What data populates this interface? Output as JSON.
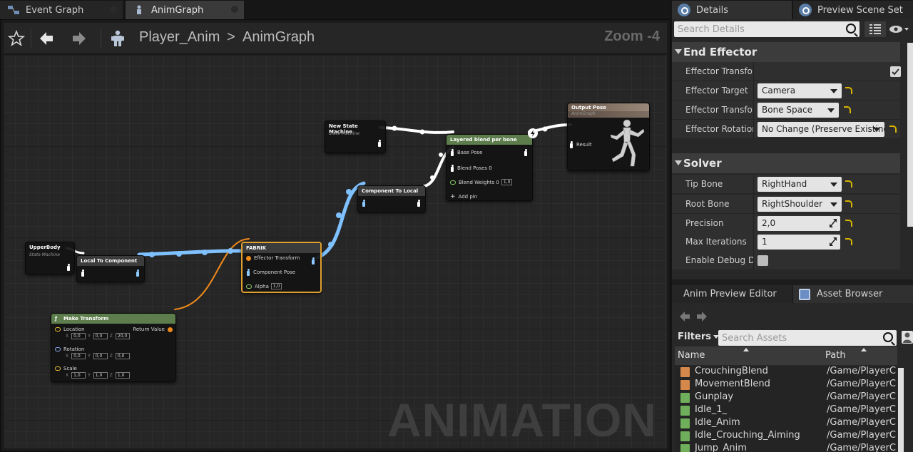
{
  "tabs": [
    {
      "label": "Event Graph",
      "active": false
    },
    {
      "label": "AnimGraph",
      "active": true
    }
  ],
  "breadcrumb": {
    "asset": "Player_Anim",
    "separator": ">",
    "graph": "AnimGraph",
    "zoom": "Zoom -4"
  },
  "watermark": "ANIMATION",
  "nodes": {
    "new_state_machine": {
      "title": "New State Machine",
      "subtitle": "State Machine"
    },
    "upper_body": {
      "title": "UpperBody",
      "subtitle": "State Machine"
    },
    "local_to_component": {
      "title": "Local To Component"
    },
    "component_to_local": {
      "title": "Component To Local"
    },
    "layered_blend": {
      "title": "Layered blend per bone",
      "pins": {
        "base_pose": "Base Pose",
        "blend_poses": "Blend Poses 0",
        "blend_weights": "Blend Weights 0",
        "blend_weights_value": "1,0",
        "add_pin": "Add pin"
      }
    },
    "output_pose": {
      "title": "Output Pose",
      "subtitle": "AnimGraph",
      "pin": "Result"
    },
    "fabrik": {
      "title": "FABRIK",
      "pins": {
        "effector": "Effector Transform",
        "component_pose": "Component Pose",
        "alpha": "Alpha",
        "alpha_value": "1,0"
      }
    },
    "make_transform": {
      "title": "Make Transform",
      "return_value": "Return Value",
      "location": {
        "label": "Location",
        "x": "0,0",
        "y": "0,0",
        "z": "20,0"
      },
      "rotation": {
        "label": "Rotation",
        "x": "0,0",
        "y": "0,0",
        "z": "0,0"
      },
      "scale": {
        "label": "Scale",
        "x": "1,0",
        "y": "1,0",
        "z": "1,0"
      },
      "axis": {
        "x": "X",
        "y": "Y",
        "z": "Z"
      }
    }
  },
  "right_tabs": [
    {
      "label": "Details"
    },
    {
      "label": "Preview Scene Set"
    }
  ],
  "details": {
    "search_placeholder": "Search Details",
    "sections": {
      "end_effector": {
        "title": "End Effector",
        "props": [
          {
            "name": "Effector Transform",
            "type": "checkbox",
            "checked": true
          },
          {
            "name": "Effector Target",
            "type": "combo",
            "value": "Camera"
          },
          {
            "name": "Effector Transform",
            "type": "combo",
            "value": "Bone Space"
          },
          {
            "name": "Effector Rotation S",
            "type": "combo",
            "value": "No Change (Preserve Existing"
          }
        ]
      },
      "solver": {
        "title": "Solver",
        "props": [
          {
            "name": "Tip Bone",
            "type": "combo",
            "value": "RightHand"
          },
          {
            "name": "Root Bone",
            "type": "combo",
            "value": "RightShoulder"
          },
          {
            "name": "Precision",
            "type": "number",
            "value": "2,0"
          },
          {
            "name": "Max Iterations",
            "type": "number",
            "value": "1"
          },
          {
            "name": "Enable Debug Draw",
            "type": "checkbox",
            "checked": false
          }
        ]
      }
    }
  },
  "asset_tabs": [
    {
      "label": "Anim Preview Editor"
    },
    {
      "label": "Asset Browser"
    }
  ],
  "asset_browser": {
    "filters_label": "Filters",
    "search_placeholder": "Search Assets",
    "columns": {
      "name": "Name",
      "path": "Path"
    },
    "rows": [
      {
        "name": "CrouchingBlend",
        "path": "/Game/PlayerCh",
        "kind": "blend"
      },
      {
        "name": "MovementBlend",
        "path": "/Game/PlayerCh",
        "kind": "blend"
      },
      {
        "name": "Gunplay",
        "path": "/Game/PlayerCh",
        "kind": "anim"
      },
      {
        "name": "Idle_1_",
        "path": "/Game/PlayerCh",
        "kind": "anim"
      },
      {
        "name": "Idle_Anim",
        "path": "/Game/PlayerCh",
        "kind": "anim"
      },
      {
        "name": "Idle_Crouching_Aiming",
        "path": "/Game/PlayerCh",
        "kind": "anim"
      },
      {
        "name": "Jump_Anim",
        "path": "/Game/PlayerCh",
        "kind": "anim"
      }
    ]
  },
  "colors": {
    "fabrik_border": "#e0a030",
    "pose_wire": "#ffffff",
    "local_wire": "#7fc0ff",
    "transform_wire": "#f08a1a",
    "blend_header": "#5d7d4c",
    "reset_arrow": "#d6b400",
    "blend_asset": "#d6884a",
    "anim_asset": "#6fae5a"
  }
}
